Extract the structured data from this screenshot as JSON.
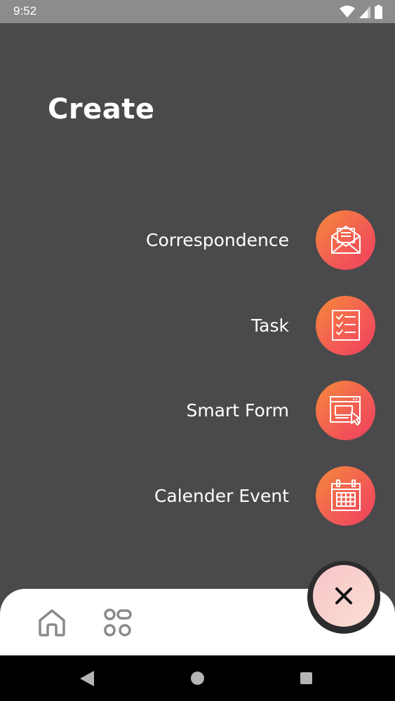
{
  "status_bar": {
    "time": "9:52",
    "icons": [
      "wifi-icon",
      "signal-icon",
      "battery-icon"
    ]
  },
  "overlay": {
    "title": "Create"
  },
  "actions": [
    {
      "label": "Correspondence",
      "icon": "envelope-letter-icon"
    },
    {
      "label": "Task",
      "icon": "checklist-icon"
    },
    {
      "label": "Smart Form",
      "icon": "form-window-icon"
    },
    {
      "label": "Calender Event",
      "icon": "calendar-icon"
    }
  ],
  "bottom_nav": {
    "items": [
      {
        "icon": "home-icon"
      },
      {
        "icon": "apps-grid-icon"
      }
    ],
    "fab_icon": "close-icon"
  },
  "colors": {
    "overlay_background": "#4a494b",
    "action_gradient_start": "#f58a3a",
    "action_gradient_end": "#ef3f5e",
    "fab_background": "#f9d3cf"
  }
}
